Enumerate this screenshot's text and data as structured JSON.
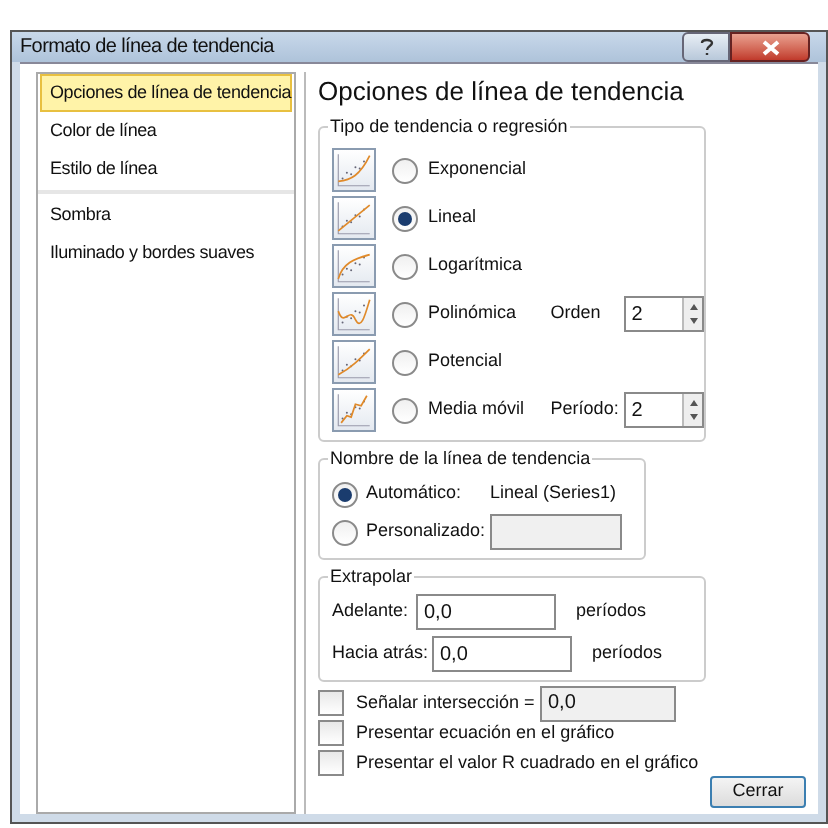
{
  "window": {
    "title": "Formato de línea de tendencia"
  },
  "sidebar": {
    "items": [
      {
        "label": "Opciones de línea de tendencia",
        "selected": true
      },
      {
        "label": "Color de línea",
        "selected": false
      },
      {
        "label": "Estilo de línea",
        "selected": false
      },
      {
        "label": "Sombra",
        "selected": false
      },
      {
        "label": "Iluminado y bordes suaves",
        "selected": false
      }
    ]
  },
  "heading": "Opciones de línea de tendencia",
  "trend_type": {
    "legend": "Tipo de tendencia o regresión",
    "options": [
      {
        "label": "Exponencial",
        "selected": false,
        "kind": "exp"
      },
      {
        "label": "Lineal",
        "selected": true,
        "kind": "linear"
      },
      {
        "label": "Logarítmica",
        "selected": false,
        "kind": "log"
      },
      {
        "label": "Polinómica",
        "selected": false,
        "kind": "poly",
        "param_label": "Orden",
        "param_value": "2"
      },
      {
        "label": "Potencial",
        "selected": false,
        "kind": "power"
      },
      {
        "label": "Media móvil",
        "selected": false,
        "kind": "moving",
        "param_label": "Período:",
        "param_value": "2"
      }
    ]
  },
  "trend_name": {
    "legend": "Nombre de la línea de tendencia",
    "options": [
      {
        "label": "Automático:",
        "selected": true,
        "value": "Lineal (Series1)"
      },
      {
        "label": "Personalizado:",
        "selected": false
      }
    ]
  },
  "extrapolate": {
    "legend": "Extrapolar",
    "rows": [
      {
        "label": "Adelante:",
        "value": "0,0",
        "unit": "períodos"
      },
      {
        "label": "Hacia atrás:",
        "value": "0,0",
        "unit": "períodos"
      }
    ]
  },
  "checks": [
    {
      "label": "Señalar intersección =",
      "checked": false,
      "value": "0,0"
    },
    {
      "label": "Presentar ecuación en el gráfico",
      "checked": false
    },
    {
      "label": "Presentar el valor R cuadrado en el gráfico",
      "checked": false
    }
  ],
  "close_button": "Cerrar"
}
